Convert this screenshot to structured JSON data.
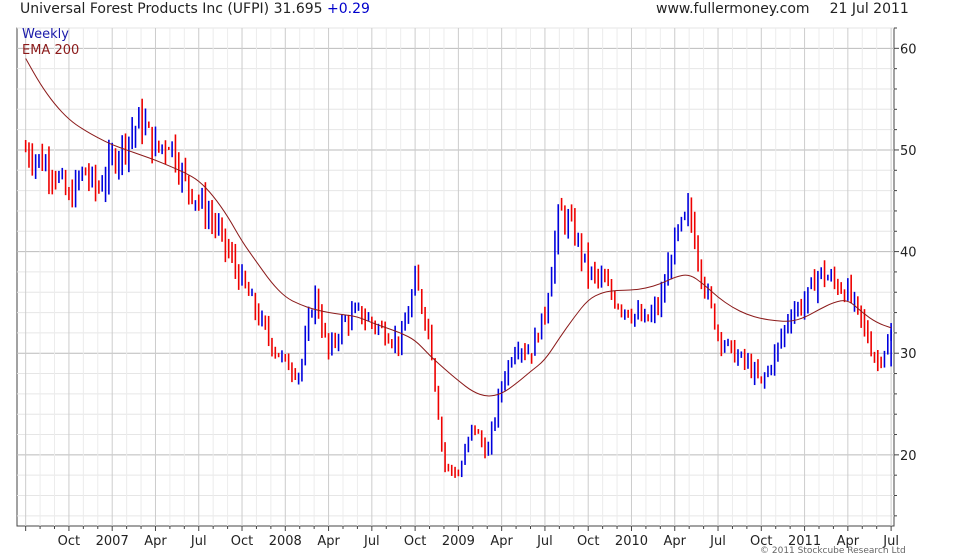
{
  "header": {
    "title": "Universal Forest Products Inc (UFPI) 31.695",
    "change": "+0.29",
    "site": "www.fullermoney.com",
    "date": "21 Jul 2011"
  },
  "legend": {
    "series1": "Weekly",
    "series2": "EMA 200"
  },
  "copyright": "© 2011 Stockcube Research Ltd",
  "chart_data": {
    "type": "line",
    "title": "Universal Forest Products Inc (UFPI) 31.695 +0.29",
    "xlabel": "",
    "ylabel": "",
    "ylim": [
      13,
      62
    ],
    "y_ticks": [
      20,
      30,
      40,
      50,
      60
    ],
    "x_tick_labels": [
      "Oct",
      "2007",
      "Apr",
      "Jul",
      "Oct",
      "2008",
      "Apr",
      "Jul",
      "Oct",
      "2009",
      "Apr",
      "Jul",
      "Oct",
      "2010",
      "Apr",
      "Jul",
      "Oct",
      "2011",
      "Apr",
      "Jul"
    ],
    "grid": true,
    "legend_position": "top-left",
    "colors": {
      "up": "#0000dd",
      "down": "#ee0000",
      "ema": "#8b1a1a",
      "grid": "#dddddd"
    },
    "series": [
      {
        "name": "Weekly",
        "x": [
          "2006-07",
          "2006-08",
          "2006-09",
          "2006-10",
          "2006-11",
          "2006-12",
          "2007-01",
          "2007-02",
          "2007-03",
          "2007-04",
          "2007-05",
          "2007-06",
          "2007-07",
          "2007-08",
          "2007-09",
          "2007-10",
          "2007-11",
          "2007-12",
          "2008-01",
          "2008-02",
          "2008-03",
          "2008-04",
          "2008-05",
          "2008-06",
          "2008-07",
          "2008-08",
          "2008-09",
          "2008-10",
          "2008-11",
          "2008-12",
          "2009-01",
          "2009-02",
          "2009-03",
          "2009-04",
          "2009-05",
          "2009-06",
          "2009-07",
          "2009-08",
          "2009-09",
          "2009-10",
          "2009-11",
          "2009-12",
          "2010-01",
          "2010-02",
          "2010-03",
          "2010-04",
          "2010-05",
          "2010-06",
          "2010-07",
          "2010-08",
          "2010-09",
          "2010-10",
          "2010-11",
          "2010-12",
          "2011-01",
          "2011-02",
          "2011-03",
          "2011-04",
          "2011-05",
          "2011-06",
          "2011-07"
        ],
        "values": [
          50,
          49,
          48,
          45,
          48,
          46,
          49,
          51,
          53,
          50,
          51,
          47,
          45,
          43,
          40,
          37,
          34,
          31,
          29,
          28,
          36,
          30,
          33,
          34,
          33,
          32,
          31,
          37,
          32,
          19,
          18,
          23,
          20,
          27,
          31,
          30,
          34,
          44,
          42,
          38,
          37,
          35,
          34,
          33,
          35,
          41,
          44,
          37,
          32,
          30,
          29,
          27,
          30,
          34,
          35,
          38,
          37,
          36,
          33,
          29,
          31.7
        ]
      },
      {
        "name": "EMA 200",
        "x": [
          "2006-07",
          "2006-08",
          "2006-09",
          "2006-10",
          "2006-11",
          "2006-12",
          "2007-01",
          "2007-02",
          "2007-03",
          "2007-04",
          "2007-05",
          "2007-06",
          "2007-07",
          "2007-08",
          "2007-09",
          "2007-10",
          "2007-11",
          "2007-12",
          "2008-01",
          "2008-02",
          "2008-03",
          "2008-04",
          "2008-05",
          "2008-06",
          "2008-07",
          "2008-08",
          "2008-09",
          "2008-10",
          "2008-11",
          "2008-12",
          "2009-01",
          "2009-02",
          "2009-03",
          "2009-04",
          "2009-05",
          "2009-06",
          "2009-07",
          "2009-08",
          "2009-09",
          "2009-10",
          "2009-11",
          "2009-12",
          "2010-01",
          "2010-02",
          "2010-03",
          "2010-04",
          "2010-05",
          "2010-06",
          "2010-07",
          "2010-08",
          "2010-09",
          "2010-10",
          "2010-11",
          "2010-12",
          "2011-01",
          "2011-02",
          "2011-03",
          "2011-04",
          "2011-05",
          "2011-06",
          "2011-07"
        ],
        "values": [
          59,
          56.5,
          54.5,
          53,
          52,
          51.2,
          50.5,
          50,
          49.5,
          49,
          48.4,
          47.8,
          47,
          45.5,
          43.5,
          41,
          39,
          37,
          35.5,
          34.8,
          34.3,
          34,
          33.8,
          33.6,
          33,
          32.5,
          32,
          31.3,
          29.8,
          28.5,
          27.3,
          26.2,
          25.7,
          26,
          27,
          28.2,
          29.3,
          31.5,
          33.5,
          35.3,
          36,
          36.2,
          36.2,
          36.4,
          36.8,
          37.5,
          37.8,
          36.8,
          35.5,
          34.5,
          33.8,
          33.4,
          33.2,
          33.1,
          33.5,
          34.3,
          35,
          35.3,
          34,
          33,
          32.5
        ]
      }
    ]
  }
}
